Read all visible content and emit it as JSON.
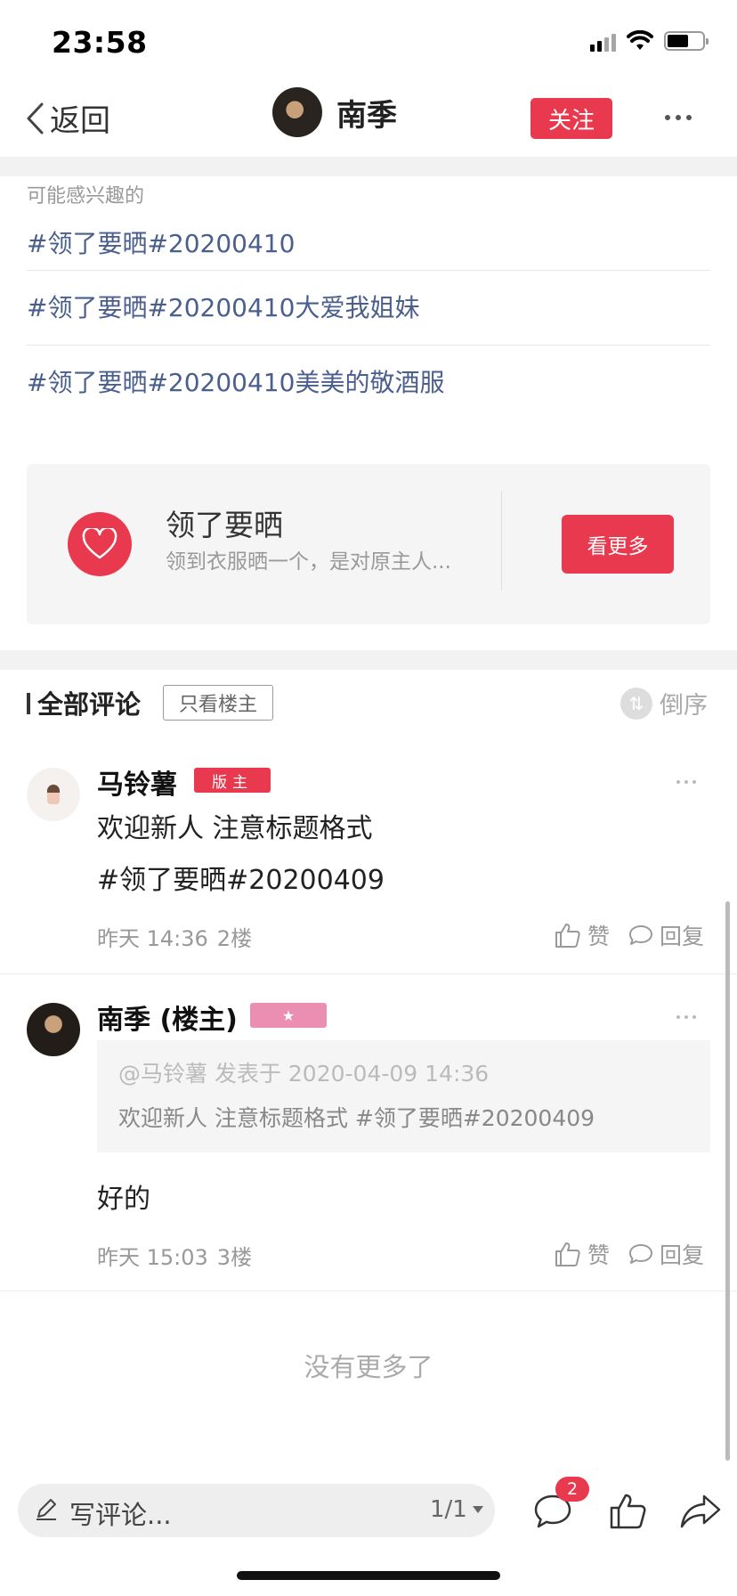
{
  "status_bar": {
    "time": "23:58",
    "battery_level": 0.6
  },
  "nav": {
    "back_label": "返回",
    "user_name": "南季",
    "follow_label": "关注"
  },
  "interest": {
    "title": "可能感兴趣的",
    "topics": [
      "#领了要晒#20200410",
      "#领了要晒#20200410大爱我姐妹",
      "#领了要晒#20200410美美的敬酒服"
    ]
  },
  "circle_card": {
    "name": "领了要晒",
    "description": "领到衣服晒一个，是对原主人...",
    "see_more_label": "看更多",
    "accent": "#e8394f"
  },
  "comments_header": {
    "title": "全部评论",
    "only_op_label": "只看楼主",
    "reverse_label": "倒序"
  },
  "comments": [
    {
      "author": "马铃薯",
      "badge": "版主",
      "lines": [
        "欢迎新人 注意标题格式",
        "#领了要晒#20200409"
      ],
      "time": "昨天 14:36",
      "floor": "2楼",
      "like_label": "赞",
      "reply_label": "回复"
    },
    {
      "author": "南季 (楼主)",
      "badge": "★",
      "quote_header": "@马铃薯 发表于 2020-04-09 14:36",
      "quote_text": "欢迎新人 注意标题格式 #领了要晒#20200409",
      "body": "好的",
      "time": "昨天 15:03",
      "floor": "3楼",
      "like_label": "赞",
      "reply_label": "回复"
    }
  ],
  "no_more_label": "没有更多了",
  "bottom_bar": {
    "input_placeholder": "写评论...",
    "page_indicator": "1/1",
    "comment_count": "2"
  }
}
